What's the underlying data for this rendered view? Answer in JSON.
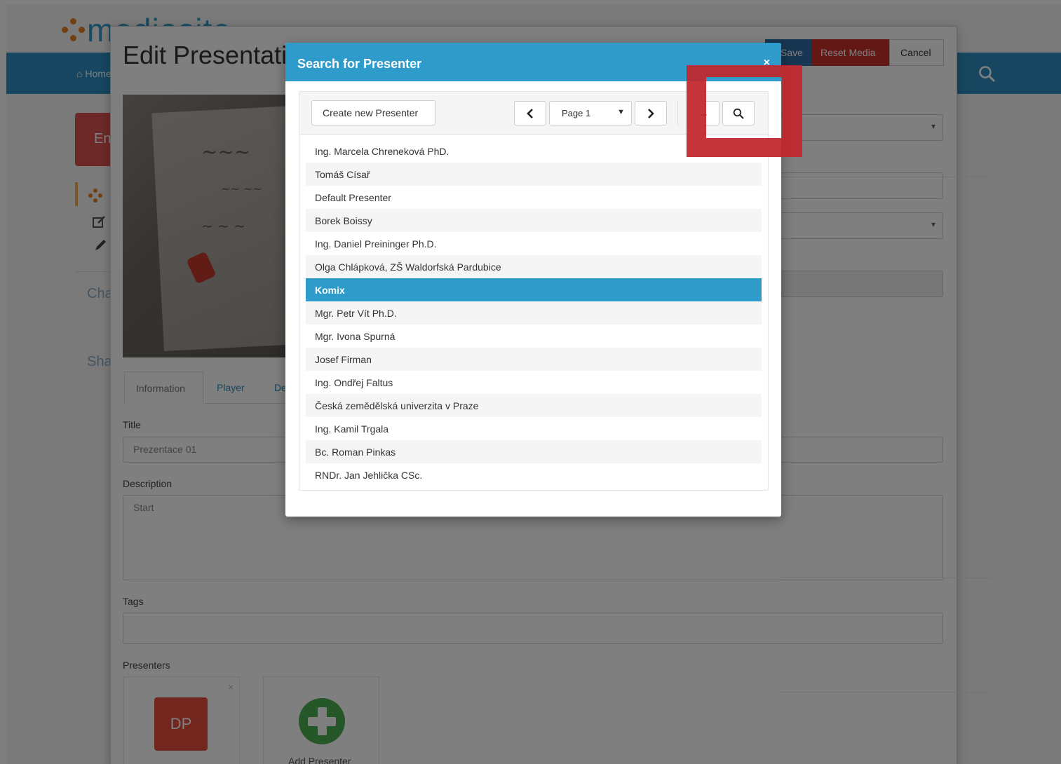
{
  "app": {
    "brand_name": "mediasite",
    "nav_home_label": "Home",
    "page_title": "Edit Presentation",
    "buttons": {
      "save": "Save",
      "reset_media": "Reset Media",
      "cancel": "Cancel"
    },
    "sidebar": {
      "red_badge": "En",
      "link_cha": "Cha",
      "link_sha": "Sha"
    },
    "tabs": [
      "Information",
      "Player",
      "De"
    ],
    "form": {
      "title_label": "Title",
      "title_value": "Prezentace 01",
      "description_label": "Description",
      "description_value": "Start",
      "tags_label": "Tags",
      "presenters_label": "Presenters"
    },
    "presenter_cards": {
      "dp_initials": "DP",
      "add_label": "Add Presenter"
    }
  },
  "modal": {
    "title": "Search for Presenter",
    "close_label": "×",
    "toolbar": {
      "create_label": "Create new Presenter",
      "page_label": "Page 1",
      "more_label": "..."
    },
    "presenters": [
      "Ing. Marcela Chreneková PhD.",
      "Tomáš Císař",
      "Default Presenter",
      "Borek Boissy",
      "Ing. Daniel Preininger Ph.D.",
      "Olga Chlápková, ZŠ Waldorfská Pardubice",
      "Komix",
      "Mgr. Petr Vít Ph.D.",
      "Mgr. Ivona Spurná",
      "Josef Firman",
      "Ing. Ondřej Faltus",
      "Česká zemědělská univerzita v Praze",
      "Ing. Kamil Trgala",
      "Bc. Roman Pinkas",
      "RNDr. Jan Jehlička CSc."
    ],
    "selected_index": 6
  },
  "colors": {
    "header_blue": "#2e9bcb",
    "nav_blue": "#2e8ec0",
    "reset_red": "#c9302c",
    "highlight_red": "#c1272d",
    "brand_orange": "#e67e22"
  }
}
